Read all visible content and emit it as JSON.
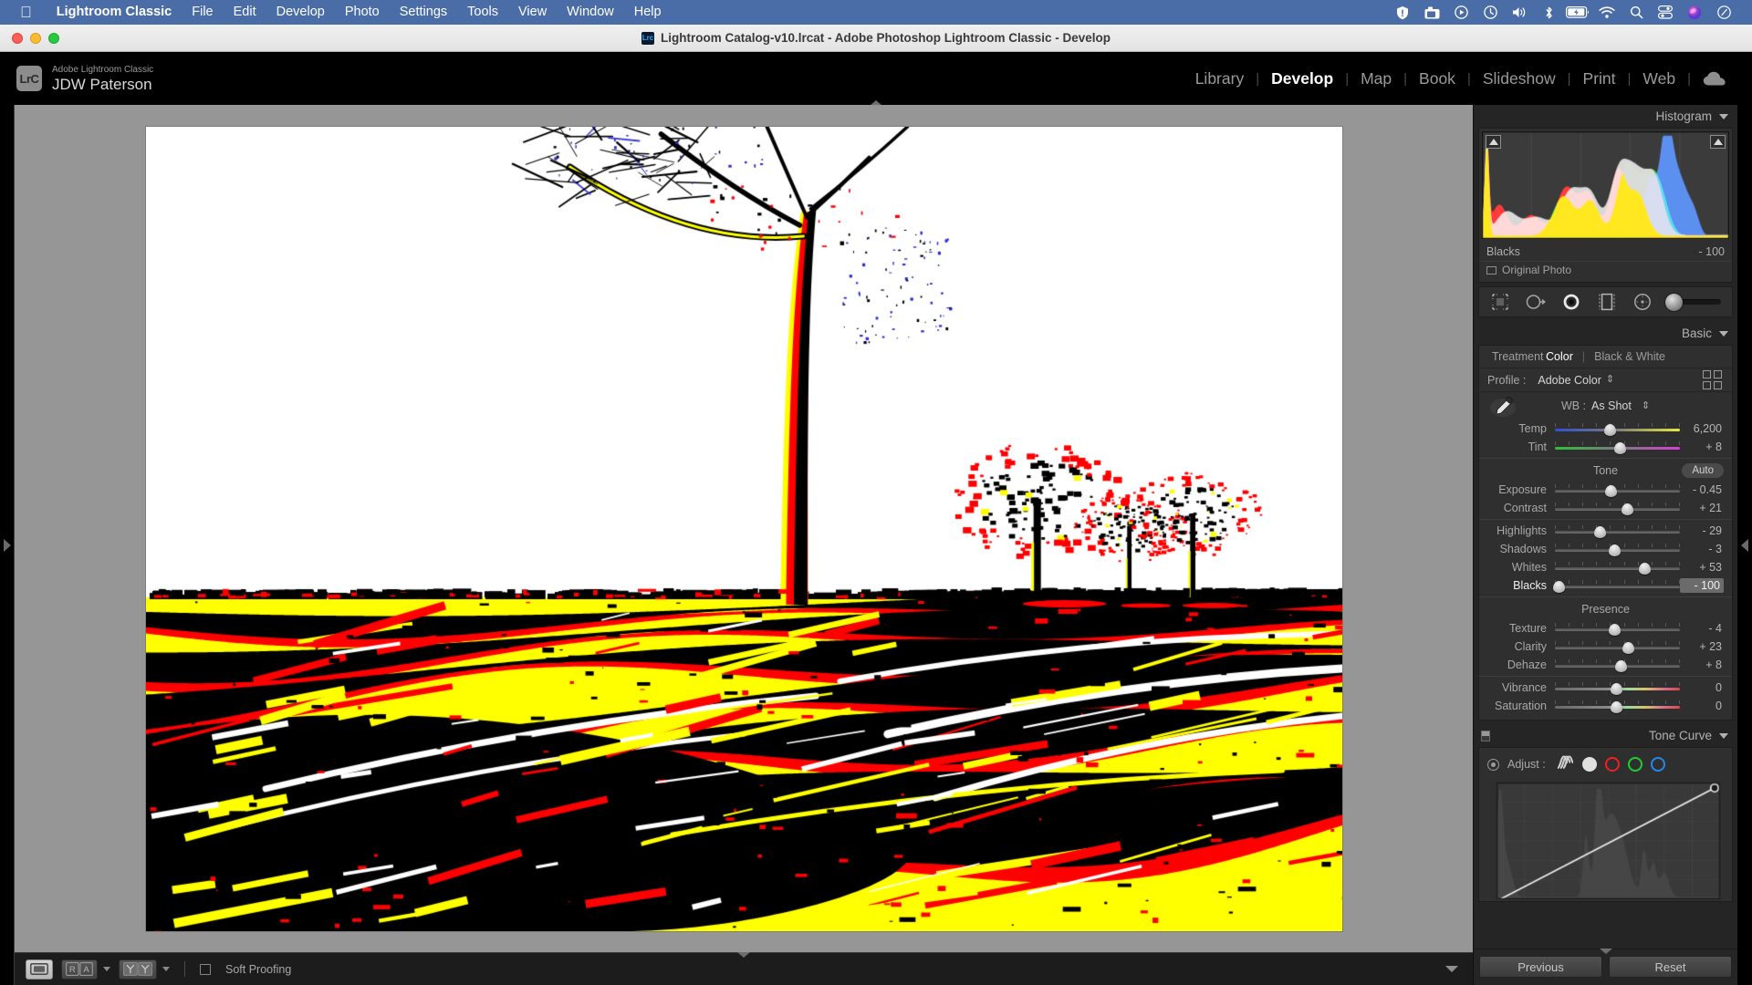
{
  "macos_menubar": {
    "apple_icon": "apple-logo-icon",
    "app_name": "Lightroom Classic",
    "menus": [
      "File",
      "Edit",
      "Develop",
      "Photo",
      "Settings",
      "Tools",
      "View",
      "Window",
      "Help"
    ],
    "status_icons": [
      "shield-icon",
      "screenshot-icon",
      "play-circle-icon",
      "time-machine-icon",
      "volume-icon",
      "bluetooth-icon",
      "battery-charging-icon",
      "wifi-icon",
      "search-icon",
      "control-center-icon",
      "siri-icon",
      "clock-icon"
    ],
    "background_color": "#4a6da7"
  },
  "window": {
    "title": "Lightroom Catalog-v10.lrcat - Adobe Photoshop Lightroom Classic - Develop",
    "app_badge": "Lrc",
    "traffic_lights": [
      "close-button",
      "minimize-button",
      "zoom-button"
    ]
  },
  "header": {
    "logo_badge": "LrC",
    "identity_line1": "Adobe Lightroom Classic",
    "identity_line2": "JDW Paterson",
    "modules": [
      {
        "label": "Library",
        "active": false
      },
      {
        "label": "Develop",
        "active": true
      },
      {
        "label": "Map",
        "active": false
      },
      {
        "label": "Book",
        "active": false
      },
      {
        "label": "Slideshow",
        "active": false
      },
      {
        "label": "Print",
        "active": false
      },
      {
        "label": "Web",
        "active": false
      }
    ],
    "cloud_icon": "cloud-sync-icon"
  },
  "toolbar": {
    "view_loupe": "loupe-view-icon",
    "view_before_after": "RA",
    "view_compare": "YY",
    "soft_proofing_label": "Soft Proofing",
    "soft_proofing_checked": false,
    "panel_caret": "chevron-down-icon"
  },
  "histogram_panel": {
    "title": "Histogram",
    "readout_label": "Blacks",
    "readout_value": "- 100",
    "original_photo_label": "Original Photo",
    "shadow_clip_icon": "shadow-clipping-toggle",
    "highlight_clip_icon": "highlight-clipping-toggle"
  },
  "tool_strip": {
    "tools": [
      "crop-overlay-icon",
      "spot-removal-icon",
      "red-eye-icon",
      "masking-icon",
      "radial-filter-icon"
    ],
    "brush_slider": "brush-size-slider"
  },
  "basic_panel": {
    "title": "Basic",
    "treatment_label": "Treatment :",
    "treatment_options": [
      {
        "label": "Color",
        "selected": true
      },
      {
        "label": "Black & White",
        "selected": false
      }
    ],
    "profile_label": "Profile :",
    "profile_value": "Adobe Color",
    "profile_browser_icon": "profile-browser-grid-icon",
    "wb_label": "WB :",
    "wb_value": "As Shot",
    "eyedropper_icon": "white-balance-eyedropper-icon",
    "wb_sliders": [
      {
        "name": "Temp",
        "value": "6,200",
        "pos": 44,
        "track": "temp",
        "active": false
      },
      {
        "name": "Tint",
        "value": "+ 8",
        "pos": 52,
        "track": "tint",
        "active": false
      }
    ],
    "tone_title": "Tone",
    "auto_label": "Auto",
    "tone_sliders": [
      {
        "name": "Exposure",
        "value": "- 0.45",
        "pos": 45,
        "track": "plain",
        "active": false
      },
      {
        "name": "Contrast",
        "value": "+ 21",
        "pos": 58,
        "track": "plain",
        "active": false
      }
    ],
    "tone_sliders2": [
      {
        "name": "Highlights",
        "value": "- 29",
        "pos": 36,
        "track": "plain",
        "active": false
      },
      {
        "name": "Shadows",
        "value": "- 3",
        "pos": 48,
        "track": "plain",
        "active": false
      },
      {
        "name": "Whites",
        "value": "+ 53",
        "pos": 72,
        "track": "plain",
        "active": false
      },
      {
        "name": "Blacks",
        "value": "- 100",
        "pos": 3,
        "track": "plain",
        "active": true
      }
    ],
    "presence_title": "Presence",
    "presence_sliders": [
      {
        "name": "Texture",
        "value": "- 4",
        "pos": 48,
        "track": "plain",
        "active": false
      },
      {
        "name": "Clarity",
        "value": "+ 23",
        "pos": 59,
        "track": "plain",
        "active": false
      },
      {
        "name": "Dehaze",
        "value": "+ 8",
        "pos": 53,
        "track": "plain",
        "active": false
      }
    ],
    "color_sliders": [
      {
        "name": "Vibrance",
        "value": "0",
        "pos": 49,
        "track": "vib",
        "active": false
      },
      {
        "name": "Saturation",
        "value": "0",
        "pos": 49,
        "track": "sat",
        "active": false
      }
    ]
  },
  "tone_curve_panel": {
    "title": "Tone Curve",
    "adjust_label": "Adjust :",
    "target_icon": "targeted-adjustment-icon",
    "channels": [
      {
        "name": "parametric-curve-icon",
        "color": "#cfcfcf"
      },
      {
        "name": "point-curve-white-icon",
        "color": "#e0e0e0"
      },
      {
        "name": "red-channel-icon",
        "color": "#ee2222"
      },
      {
        "name": "green-channel-icon",
        "color": "#22cc33"
      },
      {
        "name": "blue-channel-icon",
        "color": "#2288ee"
      }
    ]
  },
  "right_bottom": {
    "previous_label": "Previous",
    "reset_label": "Reset"
  },
  "photo": {
    "description": "Lone leaning tree in field with clipping-warning overlay",
    "clipping_colors": {
      "shadow_clip": "#000000",
      "highlight_clip": "#ff0000",
      "midtone": "#ffff00",
      "background": "#ffffff"
    }
  },
  "panel_arrows": {
    "left": "expand-left-panel-arrow",
    "right": "expand-right-panel-arrow"
  }
}
